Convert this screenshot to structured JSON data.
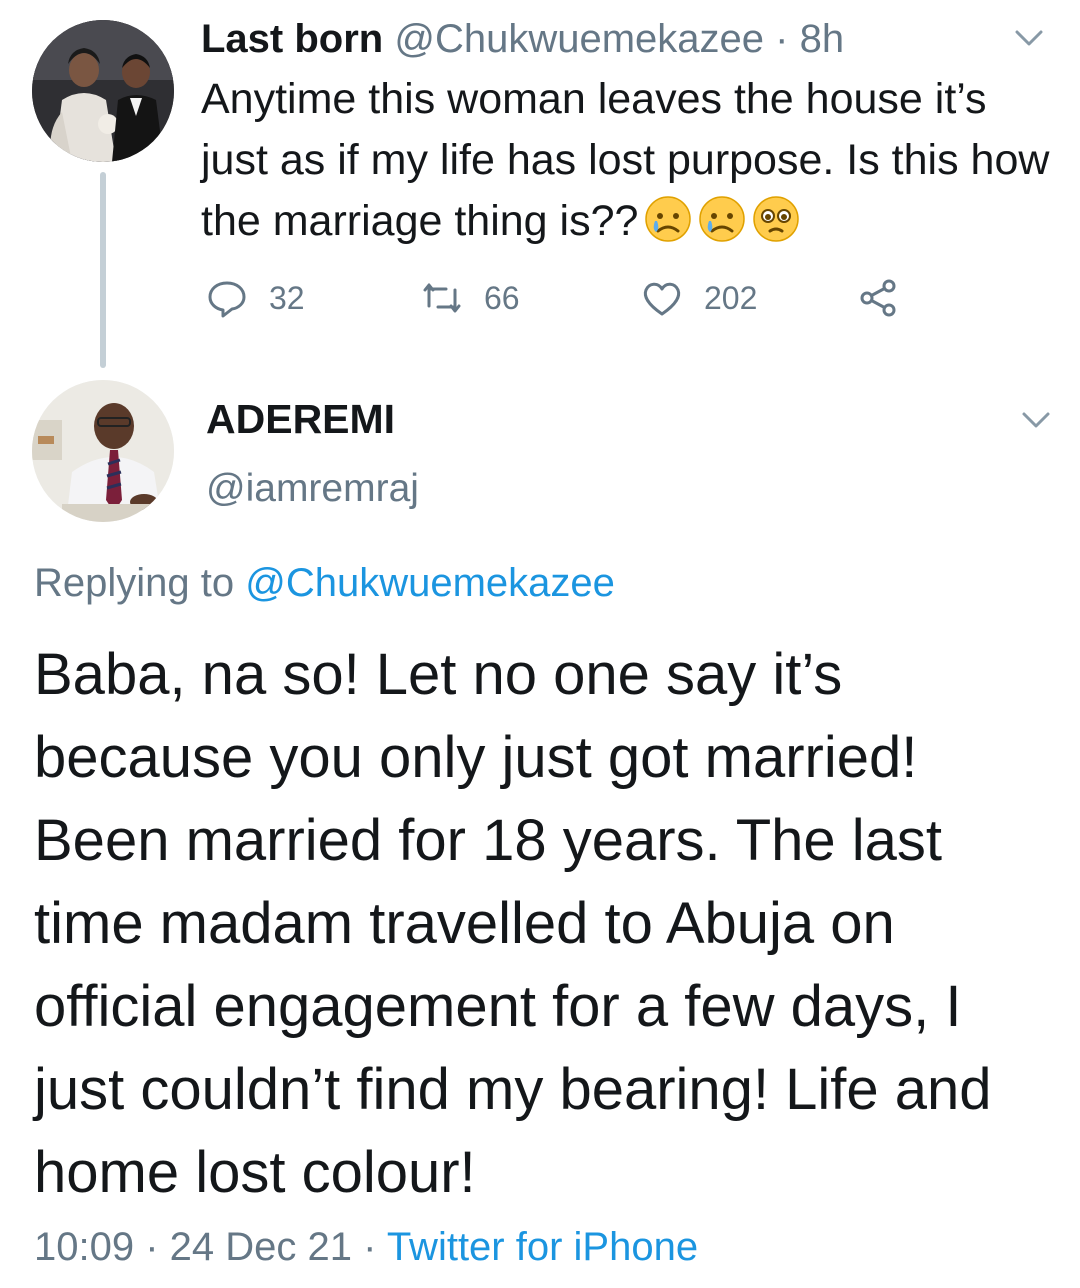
{
  "parent_tweet": {
    "display_name": "Last born",
    "handle": "@Chukwuemekazee",
    "separator": " · ",
    "time_ago": "8h",
    "text": "Anytime this woman leaves the house it’s just as if my life has lost purpose. Is this how the marriage thing is??",
    "emoji": [
      "crying-face-icon",
      "crying-face-icon",
      "pleading-face-icon"
    ],
    "reply_count": "32",
    "retweet_count": "66",
    "like_count": "202"
  },
  "reply_tweet": {
    "display_name": "ADEREMI",
    "handle": "@iamremraj",
    "replying_prefix": "Replying to ",
    "replying_to": "@Chukwuemekazee",
    "text": "Baba, na so! Let no one say it’s because you only just got married! Been married for 18 years. The last time madam travelled to Abuja on official engagement for a few days, I just couldn’t find my bearing! Life and home lost colour!",
    "time": "10:09",
    "date": "24 Dec 21",
    "separator": " · ",
    "source": "Twitter for iPhone"
  },
  "colors": {
    "text": "#14171a",
    "secondary": "#657786",
    "link": "#1b95e0",
    "thread_line": "#c4cfd6"
  }
}
